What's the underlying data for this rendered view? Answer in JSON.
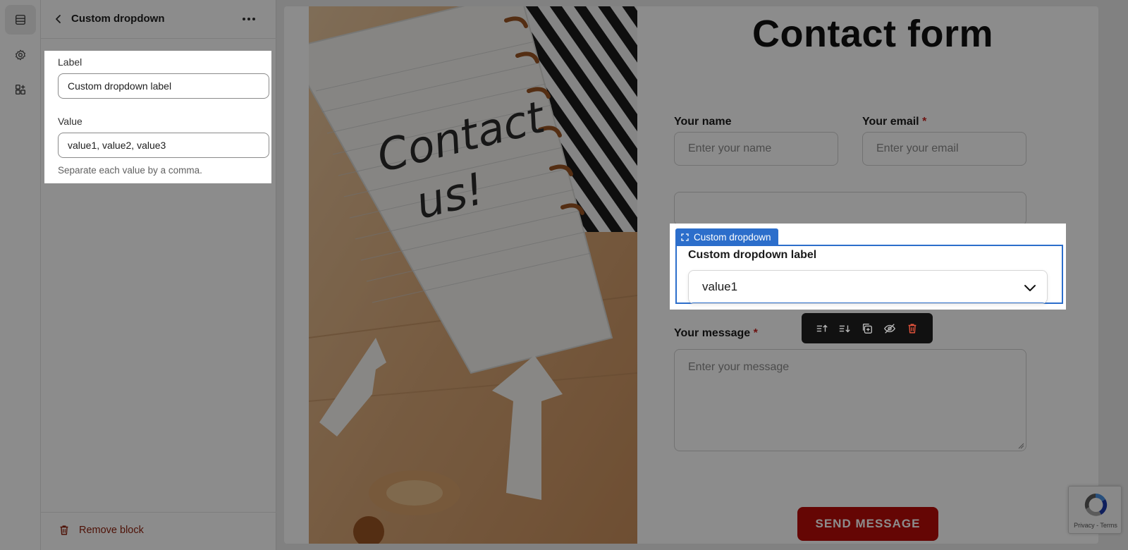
{
  "rail": {
    "items": [
      {
        "icon": "sections-icon",
        "active": true
      },
      {
        "icon": "gear-icon",
        "active": false
      },
      {
        "icon": "apps-add-icon",
        "active": false
      }
    ]
  },
  "panel": {
    "title": "Custom dropdown",
    "label_field": {
      "label": "Label",
      "value": "Custom dropdown label"
    },
    "value_field": {
      "label": "Value",
      "value": "value1, value2, value3",
      "help": "Separate each value by a comma."
    },
    "remove_label": "Remove block"
  },
  "preview": {
    "title": "Contact form",
    "name": {
      "label": "Your name",
      "placeholder": "Enter your name"
    },
    "email": {
      "label": "Your email",
      "required_mark": "*",
      "placeholder": "Enter your email"
    },
    "dropdown": {
      "tag": "Custom dropdown",
      "label": "Custom dropdown label",
      "selected": "value1"
    },
    "message": {
      "label": "Your message",
      "required_mark": "*",
      "placeholder": "Enter your message"
    },
    "send_label": "SEND MESSAGE",
    "photo_text": "Contact us!",
    "recaptcha_text": "Privacy - Terms"
  },
  "colors": {
    "accent": "#2c6ecb",
    "danger": "#b80c09",
    "remove_text": "#8e1f0b"
  }
}
